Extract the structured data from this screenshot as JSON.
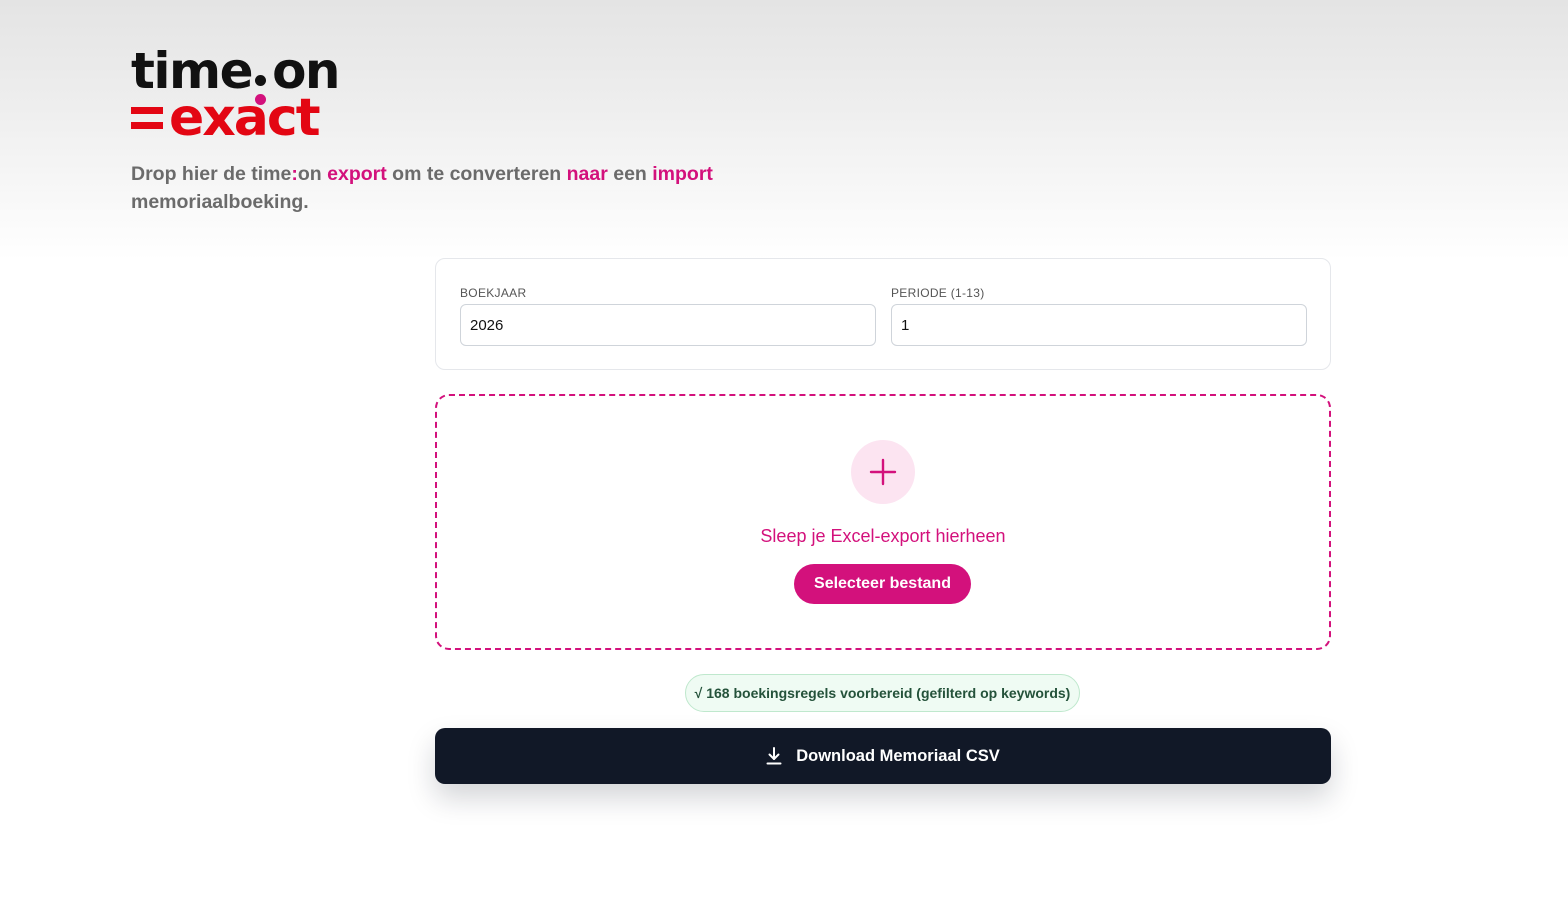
{
  "brand": {
    "top_left": "time",
    "top_right": "on",
    "bottom": "exact"
  },
  "tagline": {
    "part1": "Drop hier de time",
    "colon": ":",
    "part2": "on ",
    "export": "export",
    "part3": " om te converteren ",
    "naar": "naar",
    "part4": " een ",
    "import": "import",
    "part5": " memoriaalboeking."
  },
  "settings": {
    "boekjaar_label": "BOEKJAAR",
    "boekjaar_value": "2026",
    "periode_label": "PERIODE (1-13)",
    "periode_value": "1"
  },
  "dropzone": {
    "icon": "plus-icon",
    "text": "Sleep je Excel-export hierheen",
    "button_label": "Selecteer bestand"
  },
  "status": {
    "text": "√ 168 boekingsregels voorbereid (gefilterd op keywords)"
  },
  "download": {
    "icon": "download-icon",
    "label": "Download Memoriaal CSV"
  },
  "colors": {
    "accent": "#d3117c",
    "exact_red": "#e30613",
    "dark": "#111827",
    "success_bg": "#effbf3"
  }
}
